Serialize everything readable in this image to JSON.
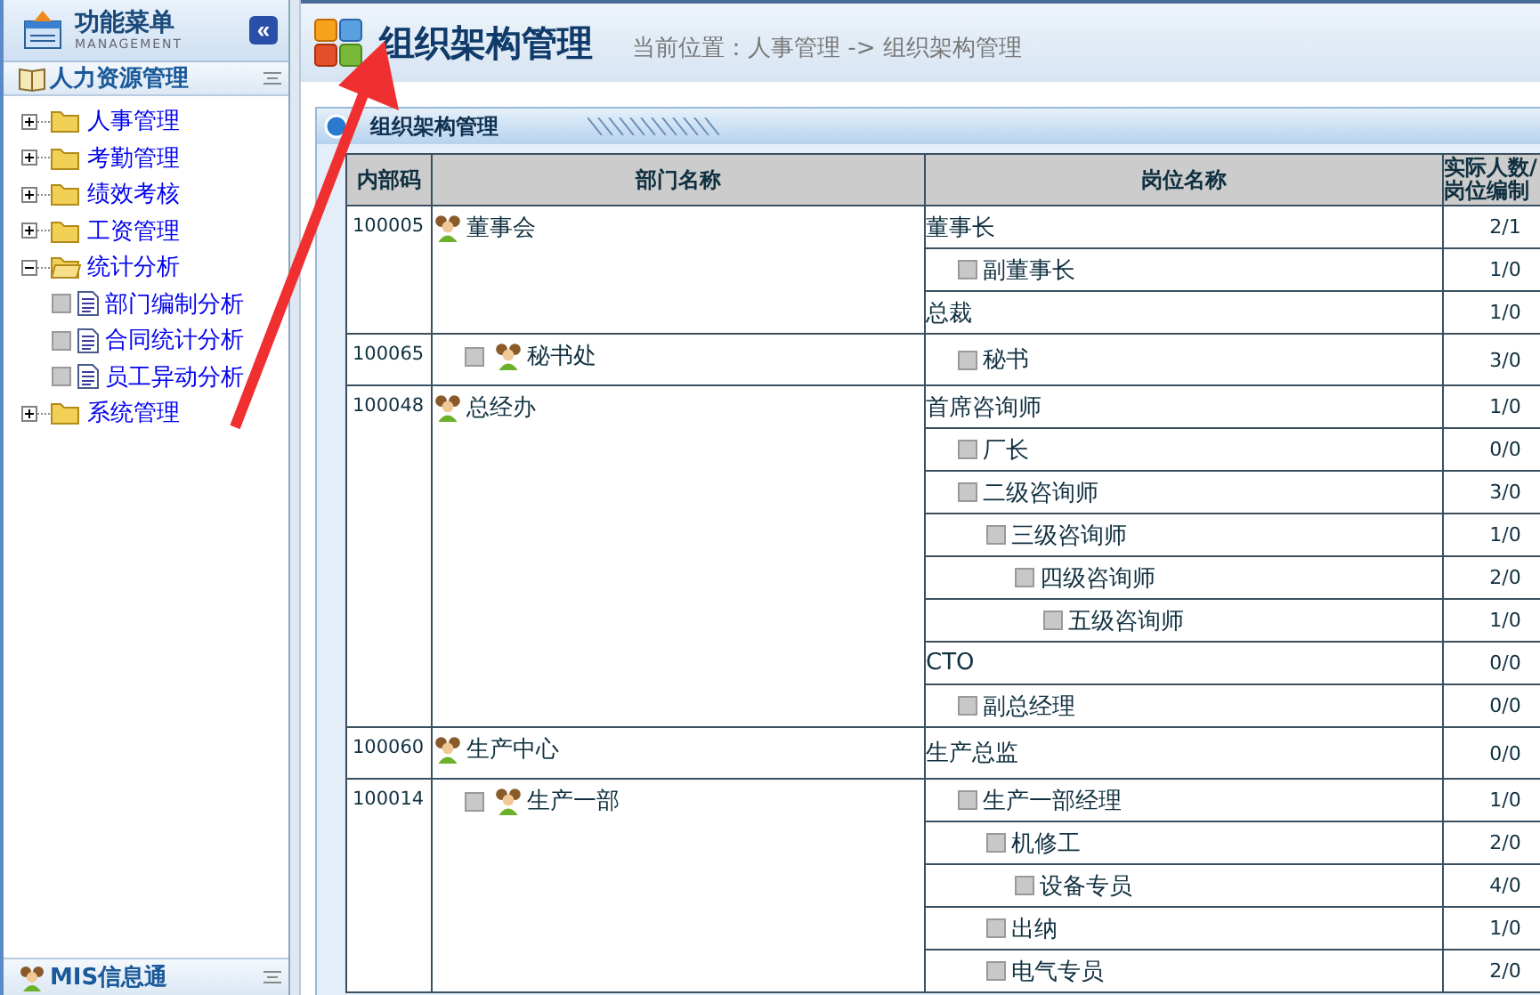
{
  "sidebar": {
    "title": "功能菜单",
    "subtitle": "MANAGEMENT",
    "collapse_button": "«",
    "section": {
      "title": "人力资源管理",
      "items": [
        {
          "label": "人事管理",
          "expanded": false
        },
        {
          "label": "考勤管理",
          "expanded": false
        },
        {
          "label": "绩效考核",
          "expanded": false
        },
        {
          "label": "工资管理",
          "expanded": false
        },
        {
          "label": "统计分析",
          "expanded": true,
          "children": [
            {
              "label": "部门编制分析"
            },
            {
              "label": "合同统计分析"
            },
            {
              "label": "员工异动分析"
            }
          ]
        },
        {
          "label": "系统管理",
          "expanded": false
        }
      ]
    },
    "bottom_section": {
      "title": "MIS信息通"
    }
  },
  "header": {
    "title": "组织架构管理",
    "breadcrumb": "当前位置：人事管理 -> 组织架构管理"
  },
  "panel": {
    "title": "组织架构管理"
  },
  "table": {
    "columns": [
      "内部码",
      "部门名称",
      "岗位名称"
    ],
    "last_column_lines": [
      "实际人数/",
      "岗位编制"
    ],
    "departments": [
      {
        "code": "100005",
        "name": "董事会",
        "kind": "top",
        "positions": [
          {
            "name": "董事长",
            "count": "2/1",
            "children": [
              {
                "name": "副董事长",
                "count": "1/0"
              }
            ]
          },
          {
            "name": "总裁",
            "count": "1/0"
          }
        ]
      },
      {
        "code": "100065",
        "name": "秘书处",
        "kind": "sub",
        "positions": [
          {
            "name": "秘书",
            "count": "3/0"
          }
        ]
      },
      {
        "code": "100048",
        "name": "总经办",
        "kind": "top",
        "positions": [
          {
            "name": "首席咨询师",
            "count": "1/0",
            "children": [
              {
                "name": "厂长",
                "count": "0/0"
              },
              {
                "name": "二级咨询师",
                "count": "3/0",
                "children": [
                  {
                    "name": "三级咨询师",
                    "count": "1/0",
                    "children": [
                      {
                        "name": "四级咨询师",
                        "count": "2/0",
                        "children": [
                          {
                            "name": "五级咨询师",
                            "count": "1/0"
                          }
                        ]
                      }
                    ]
                  }
                ]
              }
            ]
          },
          {
            "name": "CTO",
            "count": "0/0",
            "children": [
              {
                "name": "副总经理",
                "count": "0/0"
              }
            ]
          }
        ]
      },
      {
        "code": "100060",
        "name": "生产中心",
        "kind": "top",
        "positions": [
          {
            "name": "生产总监",
            "count": "0/0"
          }
        ]
      },
      {
        "code": "100014",
        "name": "生产一部",
        "kind": "sub",
        "positions": [
          {
            "name": "生产一部经理",
            "count": "1/0",
            "children": [
              {
                "name": "机修工",
                "count": "2/0",
                "children": [
                  {
                    "name": "设备专员",
                    "count": "4/0"
                  }
                ]
              },
              {
                "name": "出纳",
                "count": "1/0"
              },
              {
                "name": "电气专员",
                "count": "2/0"
              }
            ]
          }
        ]
      }
    ]
  }
}
